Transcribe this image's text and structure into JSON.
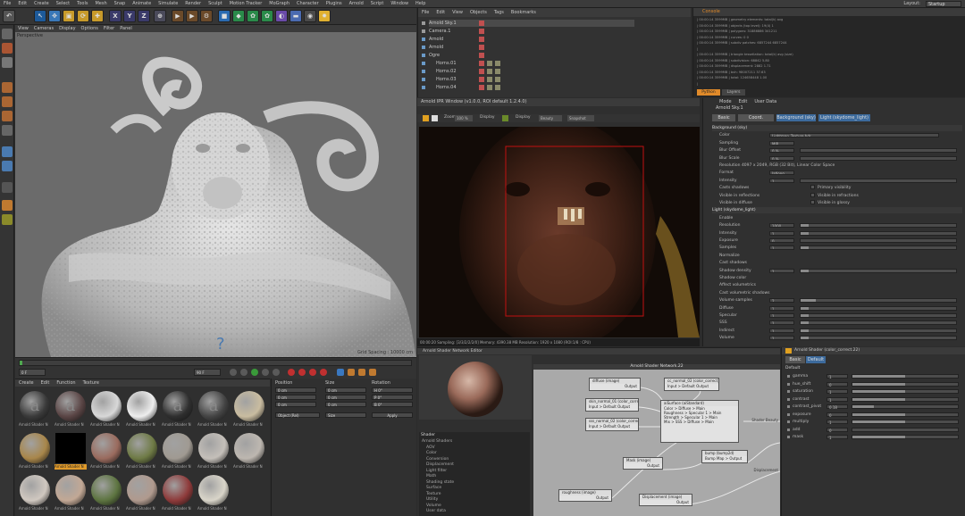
{
  "menu": {
    "items": [
      "File",
      "Edit",
      "Create",
      "Select",
      "Tools",
      "Mesh",
      "Snap",
      "Animate",
      "Simulate",
      "Render",
      "Sculpt",
      "Motion Tracker",
      "MoGraph",
      "Character",
      "Plugins",
      "Arnold",
      "Script",
      "Window",
      "Help"
    ],
    "layout_label": "Layout:",
    "layout_value": "Startup"
  },
  "toolbar": {
    "axis_x": "X",
    "axis_y": "Y",
    "axis_z": "Z"
  },
  "viewport": {
    "menu": [
      "View",
      "Cameras",
      "Display",
      "Options",
      "Filter",
      "Panel"
    ],
    "label": "Perspective",
    "info": "Grid Spacing : 10000 cm"
  },
  "timeline": {
    "start_frame": "0 F",
    "end_frame": "90 F"
  },
  "material_manager": {
    "menu": [
      "Create",
      "Edit",
      "Function",
      "Texture"
    ],
    "materials": [
      {
        "label": "Arnold Shader N",
        "color": "#3a3a3a",
        "letter": "a"
      },
      {
        "label": "Arnold Shader N",
        "color": "#5a4545",
        "letter": "a"
      },
      {
        "label": "Arnold Shader N",
        "color": "#d8d8d8",
        "letter": ""
      },
      {
        "label": "Arnold Shader N",
        "color": "#eeeeee",
        "letter": ""
      },
      {
        "label": "Arnold Shader N",
        "color": "#2f2f2f",
        "letter": "a"
      },
      {
        "label": "Arnold Shader N",
        "color": "#444444",
        "letter": "a"
      },
      {
        "label": "Arnold Shader N",
        "color": "#c9bca0",
        "letter": ""
      },
      {
        "label": "Arnold Shader N",
        "color": "#a8864a",
        "letter": ""
      },
      {
        "label": "Arnold Shader N",
        "color": "#000000",
        "letter": ""
      },
      {
        "label": "Arnold Shader N",
        "color": "#9a6b5e",
        "letter": ""
      },
      {
        "label": "Arnold Shader N",
        "color": "#6e7a45",
        "letter": ""
      },
      {
        "label": "Arnold Shader N",
        "color": "#a09a92",
        "letter": ""
      },
      {
        "label": "Arnold Shader N",
        "color": "#c4bfb9",
        "letter": ""
      },
      {
        "label": "Arnold Shader N",
        "color": "#bdb7b0",
        "letter": ""
      },
      {
        "label": "Arnold Shader N",
        "color": "#d0c8c0",
        "letter": ""
      },
      {
        "label": "Arnold Shader N",
        "color": "#c2a895",
        "letter": ""
      },
      {
        "label": "Arnold Shader N",
        "color": "#5d7440",
        "letter": ""
      },
      {
        "label": "Arnold Shader N",
        "color": "#b09a8e",
        "letter": ""
      },
      {
        "label": "Arnold Shader N",
        "color": "#8e3a3a",
        "letter": ""
      },
      {
        "label": "Arnold Shader N",
        "color": "#d9d5c9",
        "letter": ""
      }
    ]
  },
  "coordinates": {
    "position_label": "Position",
    "size_label": "Size",
    "rotation_label": "Rotation",
    "rows": [
      {
        "pos": "0 cm",
        "size": "0 cm",
        "rot": "H 0°"
      },
      {
        "pos": "0 cm",
        "size": "0 cm",
        "rot": "P 0°"
      },
      {
        "pos": "0 cm",
        "size": "0 cm",
        "rot": "B 0°"
      }
    ],
    "mode_value": "Object (Rel)",
    "size_mode_value": "Size",
    "apply_label": "Apply"
  },
  "object_manager": {
    "menu": [
      "File",
      "Edit",
      "View",
      "Objects",
      "Tags",
      "Bookmarks"
    ],
    "rows": [
      "Arnold Sky.1",
      "Camera.1",
      "Arnold",
      "Arnold",
      "Ogre",
      "Horns.01",
      "Horns.02",
      "Horns.03",
      "Horns.04"
    ]
  },
  "ipr": {
    "title": "Arnold IPR Window (v1.0.0, ROI default 1.2.4.0)",
    "zoom_label": "Zoom",
    "zoom_value": "100 %",
    "display_label": "Display",
    "display_value": "Beauty",
    "snapshot_label": "Snapshot",
    "status": "00:00:20  Sampling: [3/3/2/2/2/0]  Memory: 4390.38 MB  Resolution: 1920 x 1080  (ROI:1/8 : CPU)"
  },
  "console": {
    "title": "Console",
    "lines": [
      "| 00:00:14 3599MB  | geometry elements:                       total(k)        avg",
      "| 00:00:14 3599MB  | objects (top level):                    19(4)           1",
      "| 00:00:14 3599MB  | polygons:                         31886886          341211",
      "| 00:00:14 3599MB  | curves:                                     0               0",
      "| 00:00:14 3599MB  | subdiv patches:                     6857244        6857244",
      "|",
      "| 00:00:14 3599MB  | triangle tessellation:            total(k)     avg    (size)",
      "| 00:00:14 3599MB  | subdivision:                      68842           5.80",
      "| 00:00:14 3599MB  | displacement:                     2882           1.71",
      "| 00:00:14 3599MB  | bvh:                              98007211        37.63",
      "| 00:00:14 3599MB  | total:                           124658448        1.00",
      "|"
    ],
    "tab_python": "Python",
    "tab_other": "Layers"
  },
  "attributes": {
    "menu": [
      "Mode",
      "Edit",
      "User Data"
    ],
    "object_name": "Arnold Sky.1",
    "tabs": [
      "Basic",
      "Coord.",
      "Background (sky)",
      "Light (skydome_light)"
    ],
    "rows": [
      {
        "label": "Background (sky)",
        "value": ""
      },
      {
        "label": "Color",
        "value": "Lightmap_Texture.hdr"
      },
      {
        "label": "Sampling",
        "value": "MIP"
      },
      {
        "label": "Blur Offset",
        "value": "0 %"
      },
      {
        "label": "Blur Scale",
        "value": "0 %"
      },
      {
        "label": "Resolution 4097 x 2049, RGB (32 Bit), Linear Color Space",
        "value": ""
      },
      {
        "label": "Format",
        "value": "latlong"
      },
      {
        "label": "Intensity",
        "value": "1"
      },
      {
        "label": "Casts shadows",
        "value": ""
      },
      {
        "label": "Visible in reflections",
        "value": ""
      },
      {
        "label": "Visible in diffuse",
        "value": ""
      },
      {
        "label": "Light (skydome_light)",
        "value": ""
      },
      {
        "label": "Enable",
        "value": ""
      },
      {
        "label": "Resolution",
        "value": "1000"
      },
      {
        "label": "Intensity",
        "value": "1"
      },
      {
        "label": "Exposure",
        "value": "0"
      },
      {
        "label": "Samples",
        "value": "1"
      },
      {
        "label": "Normalize",
        "value": ""
      },
      {
        "label": "Cast shadows",
        "value": ""
      },
      {
        "label": "Shadow density",
        "value": "1"
      },
      {
        "label": "Shadow color",
        "value": ""
      },
      {
        "label": "Affect volumetrics",
        "value": ""
      },
      {
        "label": "Cast volumetric shadows",
        "value": ""
      },
      {
        "label": "Volume samples",
        "value": "2"
      },
      {
        "label": "Diffuse",
        "value": "1"
      },
      {
        "label": "Specular",
        "value": "1"
      },
      {
        "label": "SSS",
        "value": "1"
      },
      {
        "label": "Indirect",
        "value": "1"
      },
      {
        "label": "Volume",
        "value": "1"
      }
    ],
    "sliders": [
      0.05,
      0.0,
      0.0,
      0.0,
      0.0,
      0.0,
      0.0,
      0.0,
      0.0,
      0.0,
      0.0,
      0.0,
      0.0,
      0.05,
      0.05,
      0.0,
      0.05,
      0.0,
      0.0,
      0.05,
      0.0,
      0.0,
      0.0,
      0.1,
      0.05,
      0.05,
      0.05,
      0.05,
      0.05
    ],
    "checks": [
      "Primary visibility",
      "Visible in refractions",
      "Visible in glossy"
    ]
  },
  "node_editor": {
    "title": "Arnold Shader Network Editor",
    "canvas_title": "Arnold Shader Network.22",
    "shaders_header": "Shader",
    "shader_items": [
      "Arnold Shaders",
      "AOV",
      "Color",
      "Conversion",
      "Displacement",
      "Light filter",
      "Math",
      "Shading state",
      "Surface",
      "Texture",
      "Utility",
      "Volume",
      "User data"
    ],
    "nodes": [
      {
        "title": "diffuse (image)",
        "body": "Output"
      },
      {
        "title": "cc_normal_02 (color_correct)",
        "body": "Input > Default Output"
      },
      {
        "title": "skin_normal_01 (color_correct)",
        "body": "Input > Default Output"
      },
      {
        "title": "sss_normal_02 (color_correct)",
        "body": "Input > Default Output"
      },
      {
        "title": "aiSurface (aiStandard)",
        "body": "Color > Diffuse > Main"
      },
      {
        "title": "bump (bump2d)",
        "body": "Bump Map > Output"
      },
      {
        "title": "Mask (image)",
        "body": "Output"
      },
      {
        "title": "roughness (image)",
        "body": "Output"
      },
      {
        "title": "Displacement (image)",
        "body": "Output"
      }
    ],
    "node_body_extra": [
      "Roughness > Specular 1 > Main",
      "Strength > Specular 1 > Main",
      "Mix > SSS > Diffuse > Main"
    ],
    "port_labels": [
      "Shader Beauty",
      "Displacement"
    ]
  },
  "node_attr": {
    "title": "Arnold Shader (color_correct.22)",
    "tabs": [
      "Basic",
      "Default"
    ],
    "section": "Default",
    "rows": [
      {
        "label": "gamma",
        "value": "1"
      },
      {
        "label": "hue_shift",
        "value": "0"
      },
      {
        "label": "saturation",
        "value": "1"
      },
      {
        "label": "contrast",
        "value": "1"
      },
      {
        "label": "contrast_pivot",
        "value": "0.18"
      },
      {
        "label": "exposure",
        "value": "0"
      },
      {
        "label": "multiply",
        "value": "1"
      },
      {
        "label": "add",
        "value": "0"
      },
      {
        "label": "mask",
        "value": "1"
      }
    ],
    "sliders": [
      0.5,
      0.5,
      0.5,
      0.5,
      0.2,
      0.5,
      0.5,
      0.0,
      0.5
    ]
  }
}
